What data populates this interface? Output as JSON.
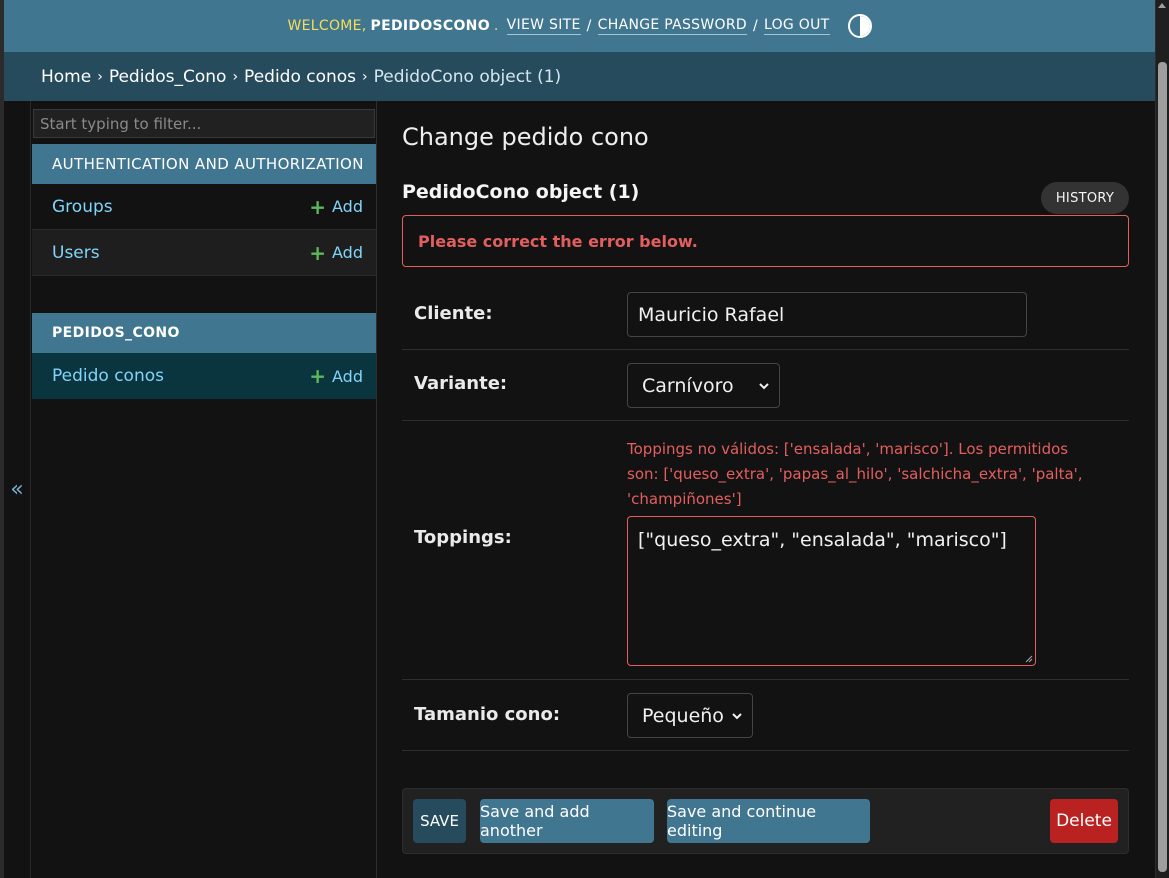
{
  "header": {
    "welcome": "WELCOME,",
    "username": "PEDIDOSCONO",
    "view_site": "VIEW SITE",
    "change_password": "CHANGE PASSWORD",
    "log_out": "LOG OUT",
    "separator": "/",
    "theme_icon": "contrast-half-circle-icon"
  },
  "breadcrumbs": {
    "items": [
      "Home",
      "Pedidos_Cono",
      "Pedido conos"
    ],
    "current": "PedidoCono object (1)",
    "arrow": "›"
  },
  "sidebar": {
    "toggle": "«",
    "filter_placeholder": "Start typing to filter...",
    "apps": [
      {
        "caption": "AUTHENTICATION AND AUTHORIZATION",
        "models": [
          {
            "name": "Groups",
            "add": "Add"
          },
          {
            "name": "Users",
            "add": "Add"
          }
        ]
      },
      {
        "caption": "PEDIDOS_CONO",
        "models": [
          {
            "name": "Pedido conos",
            "add": "Add",
            "active": true
          }
        ]
      }
    ]
  },
  "content": {
    "page_title": "Change pedido cono",
    "object_title": "PedidoCono object (1)",
    "history": "HISTORY",
    "error_note": "Please correct the error below.",
    "fields": {
      "cliente": {
        "label": "Cliente:",
        "value": "Mauricio Rafael"
      },
      "variante": {
        "label": "Variante:",
        "value": "Carnívoro"
      },
      "toppings": {
        "label": "Toppings:",
        "error": "Toppings no válidos: ['ensalada', 'marisco']. Los permitidos son: ['queso_extra', 'papas_al_hilo', 'salchicha_extra', 'palta', 'champiñones']",
        "value": "[\"queso_extra\", \"ensalada\", \"marisco\"]"
      },
      "tamanio": {
        "label": "Tamanio cono:",
        "value": "Pequeño"
      }
    },
    "buttons": {
      "save": "SAVE",
      "save_add": "Save and add another",
      "save_continue": "Save and continue editing",
      "delete": "Delete"
    }
  },
  "colors": {
    "header": "#417690",
    "breadcrumbs": "#264b5d",
    "link": "#81d4fa",
    "error": "#e35f5f",
    "delete": "#ba2121"
  }
}
